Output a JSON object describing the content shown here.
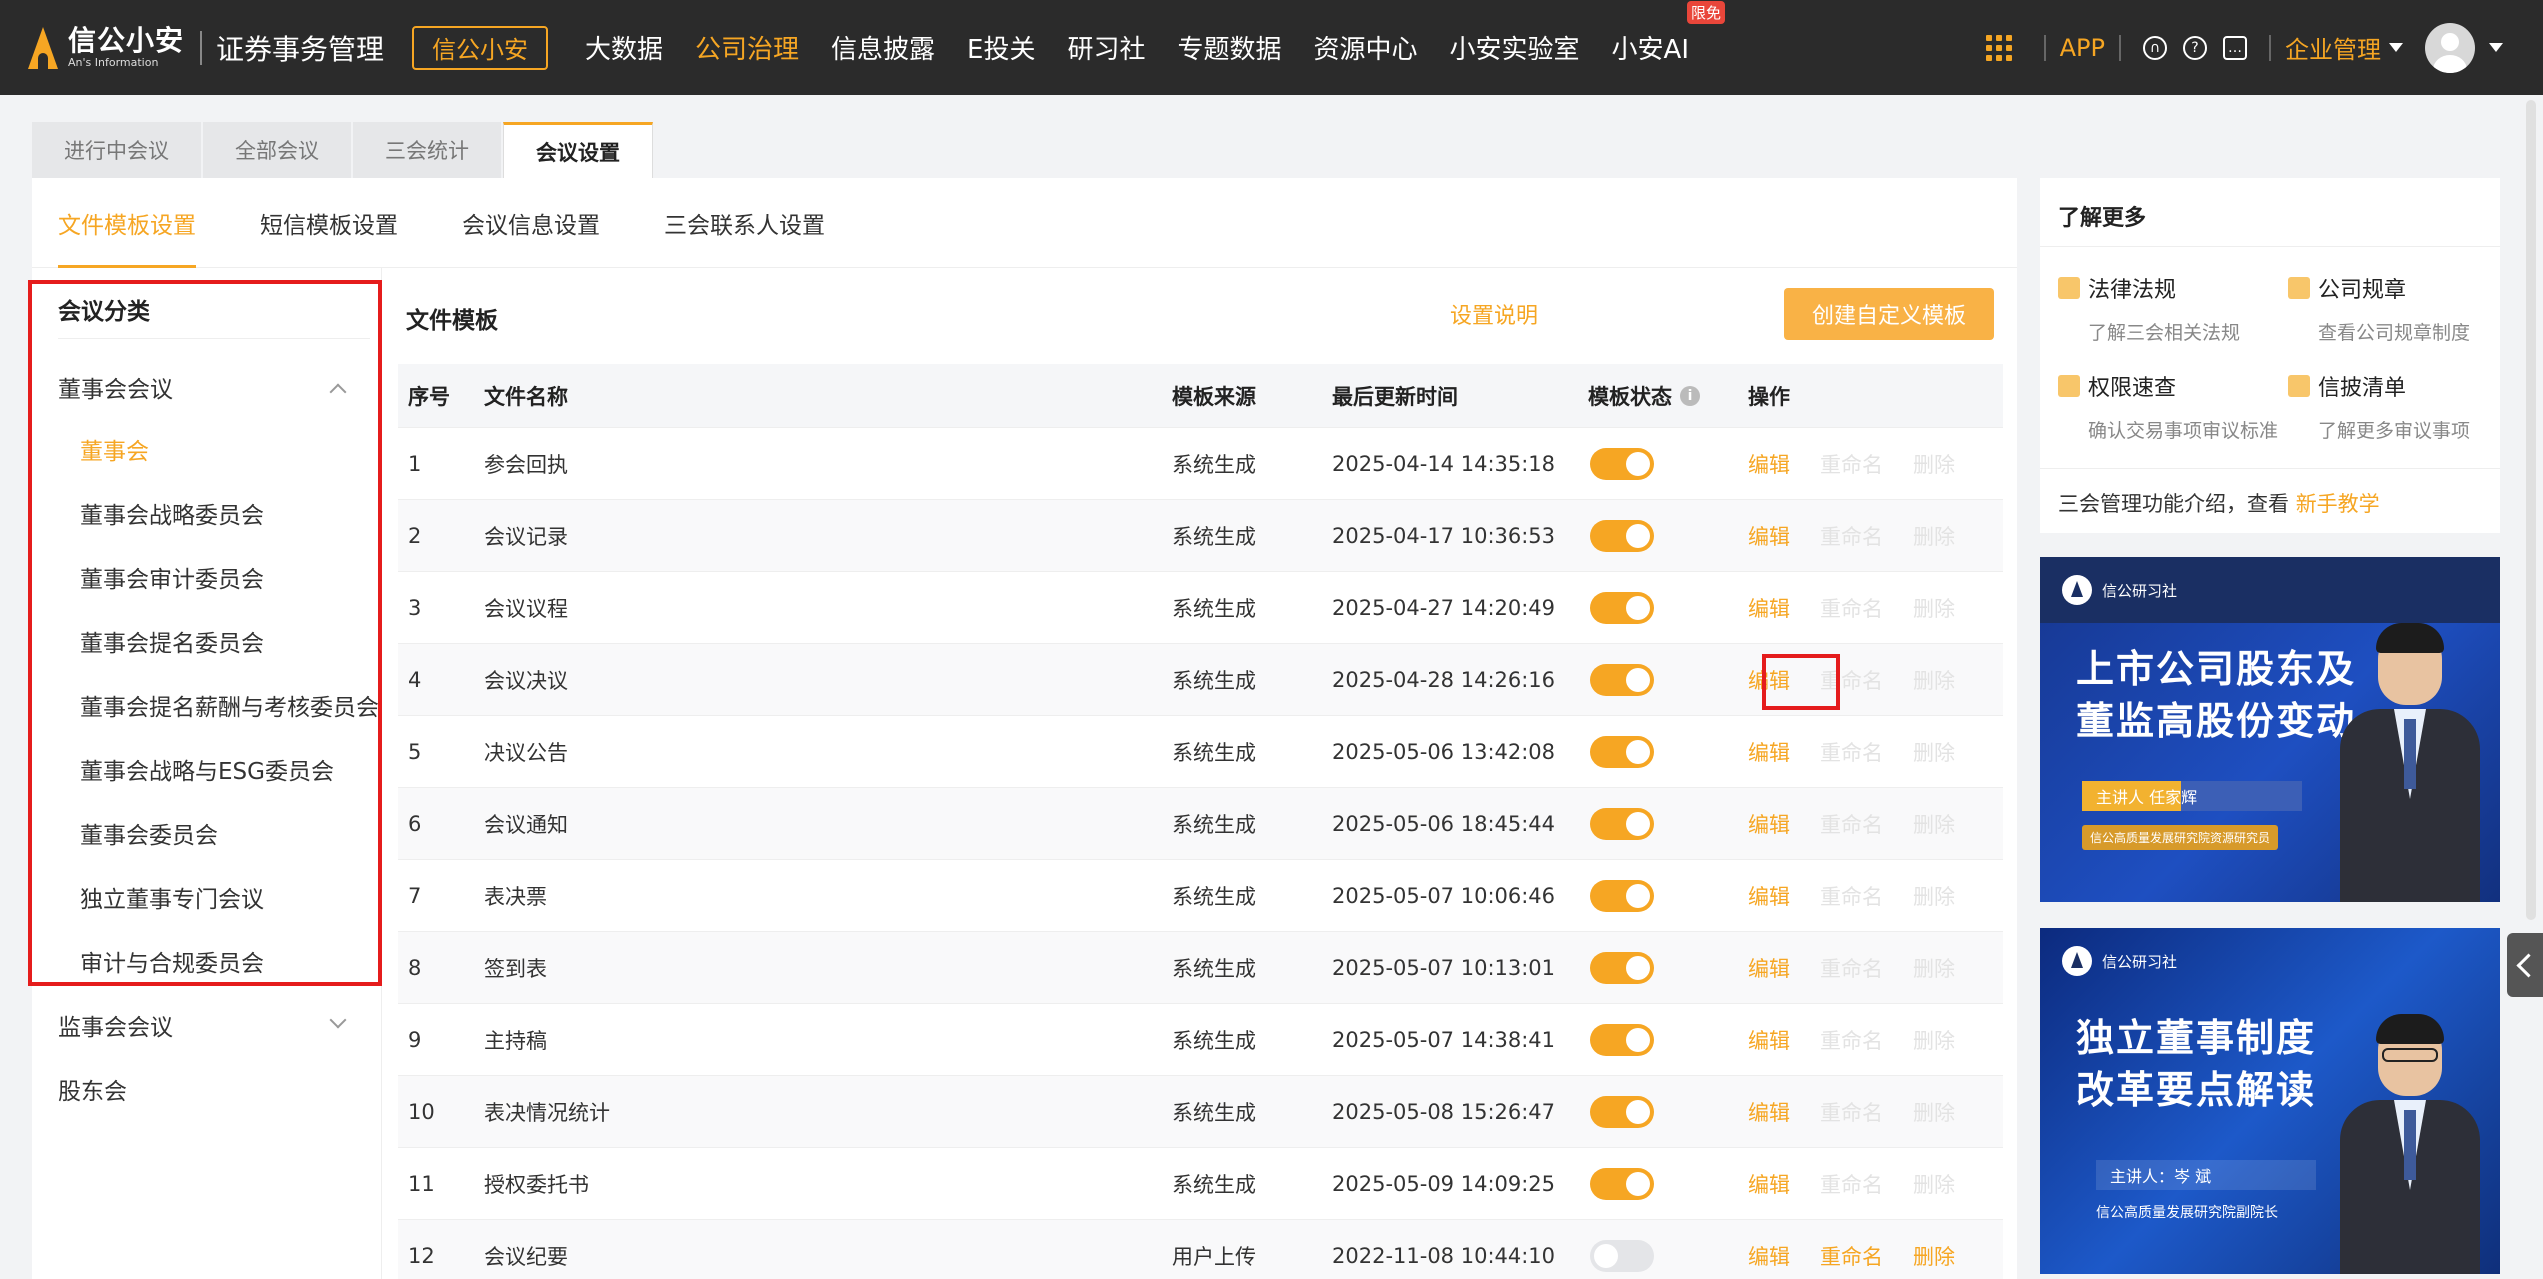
{
  "brand": {
    "name": "信公小安",
    "en": "An's Information",
    "product": "证券事务管理",
    "button": "信公小安"
  },
  "nav": {
    "items": [
      "大数据",
      "公司治理",
      "信息披露",
      "E投关",
      "研习社",
      "专题数据",
      "资源中心",
      "小安实验室",
      "小安AI"
    ],
    "active_index": 1,
    "badge": "限免"
  },
  "topright": {
    "app": "APP",
    "enterprise": "企业管理"
  },
  "page_tabs": [
    "进行中会议",
    "全部会议",
    "三会统计",
    "会议设置"
  ],
  "active_page_tab": 3,
  "sub_tabs": [
    "文件模板设置",
    "短信模板设置",
    "会议信息设置",
    "三会联系人设置"
  ],
  "active_sub_tab": 0,
  "sidebar": {
    "title": "会议分类",
    "groups": [
      {
        "label": "董事会会议",
        "expanded": true,
        "items": [
          "董事会",
          "董事会战略委员会",
          "董事会审计委员会",
          "董事会提名委员会",
          "董事会提名薪酬与考核委员会",
          "董事会战略与ESG委员会",
          "董事会委员会",
          "独立董事专门会议",
          "审计与合规委员会"
        ]
      },
      {
        "label": "监事会会议",
        "expanded": false,
        "items": []
      },
      {
        "label": "股东会",
        "expanded": false,
        "items": []
      }
    ],
    "active_item": "董事会"
  },
  "content": {
    "title": "文件模板",
    "help_link": "设置说明",
    "create_button": "创建自定义模板"
  },
  "table": {
    "headers": [
      "序号",
      "文件名称",
      "模板来源",
      "最后更新时间",
      "模板状态",
      "操作"
    ],
    "actions": [
      "编辑",
      "重命名",
      "删除"
    ],
    "rows": [
      {
        "no": "1",
        "name": "参会回执",
        "source": "系统生成",
        "time": "2025-04-14 14:35:18",
        "enabled": true
      },
      {
        "no": "2",
        "name": "会议记录",
        "source": "系统生成",
        "time": "2025-04-17 10:36:53",
        "enabled": true
      },
      {
        "no": "3",
        "name": "会议议程",
        "source": "系统生成",
        "time": "2025-04-27 14:20:49",
        "enabled": true
      },
      {
        "no": "4",
        "name": "会议决议",
        "source": "系统生成",
        "time": "2025-04-28 14:26:16",
        "enabled": true
      },
      {
        "no": "5",
        "name": "决议公告",
        "source": "系统生成",
        "time": "2025-05-06 13:42:08",
        "enabled": true
      },
      {
        "no": "6",
        "name": "会议通知",
        "source": "系统生成",
        "time": "2025-05-06 18:45:44",
        "enabled": true
      },
      {
        "no": "7",
        "name": "表决票",
        "source": "系统生成",
        "time": "2025-05-07 10:06:46",
        "enabled": true
      },
      {
        "no": "8",
        "name": "签到表",
        "source": "系统生成",
        "time": "2025-05-07 10:13:01",
        "enabled": true
      },
      {
        "no": "9",
        "name": "主持稿",
        "source": "系统生成",
        "time": "2025-05-07 14:38:41",
        "enabled": true
      },
      {
        "no": "10",
        "name": "表决情况统计",
        "source": "系统生成",
        "time": "2025-05-08 15:26:47",
        "enabled": true
      },
      {
        "no": "11",
        "name": "授权委托书",
        "source": "系统生成",
        "time": "2025-05-09 14:09:25",
        "enabled": true
      },
      {
        "no": "12",
        "name": "会议纪要",
        "source": "用户上传",
        "time": "2022-11-08 10:44:10",
        "enabled": false
      }
    ]
  },
  "learn_more": {
    "title": "了解更多",
    "cards": [
      {
        "title": "法律法规",
        "desc": "了解三会相关法规",
        "icon": "gavel-icon"
      },
      {
        "title": "公司规章",
        "desc": "查看公司规章制度",
        "icon": "book-icon"
      },
      {
        "title": "权限速查",
        "desc": "确认交易事项审议标准",
        "icon": "shield-icon"
      },
      {
        "title": "信披清单",
        "desc": "了解更多审议事项",
        "icon": "clipboard-icon"
      }
    ],
    "footer_text": "三会管理功能介绍，查看",
    "footer_link": "新手教学"
  },
  "banners": [
    {
      "brand": "信公研习社",
      "title_line1": "上市公司股东及",
      "title_line2": "董监高股份变动",
      "speaker": "主讲人   任家辉",
      "institute": "信公高质量发展研究院资源研究员"
    },
    {
      "brand": "信公研习社",
      "title_line1": "独立董事制度",
      "title_line2": "改革要点解读",
      "speaker": "主讲人：岑 斌",
      "institute": "信公高质量发展研究院副院长"
    }
  ],
  "colors": {
    "accent": "#f6a623",
    "topbar": "#2b2b2b",
    "highlight": "#e51c1c"
  }
}
